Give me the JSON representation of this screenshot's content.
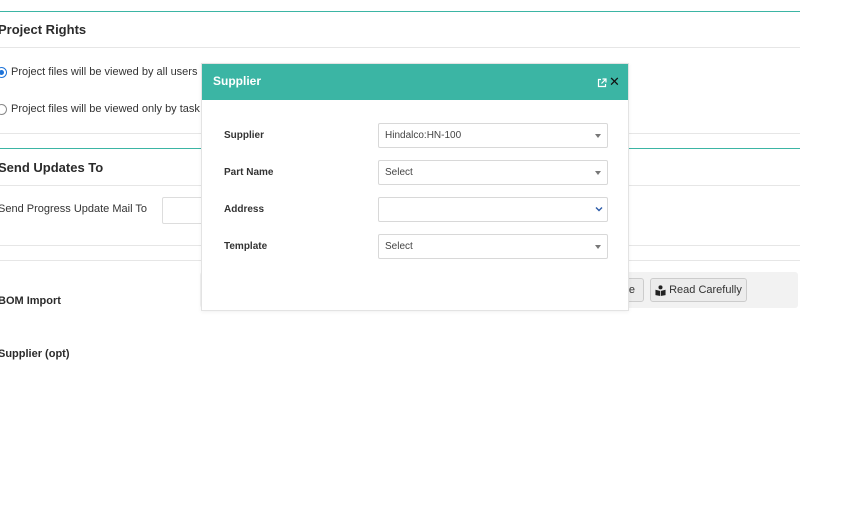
{
  "project_rights": {
    "title": "Project Rights",
    "option_all": "Project files will be viewed by all users",
    "option_task": "Project files will be viewed only by task m"
  },
  "send_updates": {
    "title": "Send Updates To",
    "mail_label": "Send Progress Update Mail To"
  },
  "bom": {
    "label": "BOM Import",
    "hidden_button_fragment": "e",
    "read_button": "Read Carefully"
  },
  "supplier_opt": {
    "label": "Supplier (opt)"
  },
  "modal": {
    "title": "Supplier",
    "fields": [
      {
        "label": "Supplier",
        "value": "Hindalco:HN-100"
      },
      {
        "label": "Part Name",
        "value": "Select"
      },
      {
        "label": "Address",
        "value": ""
      },
      {
        "label": "Template",
        "value": "Select"
      }
    ]
  },
  "colors": {
    "accent": "#3bb5a4",
    "radio_selected": "#1e73d8"
  },
  "icons": {
    "external_link": "external-link-icon",
    "close": "close-icon",
    "read": "book-reader-icon"
  }
}
